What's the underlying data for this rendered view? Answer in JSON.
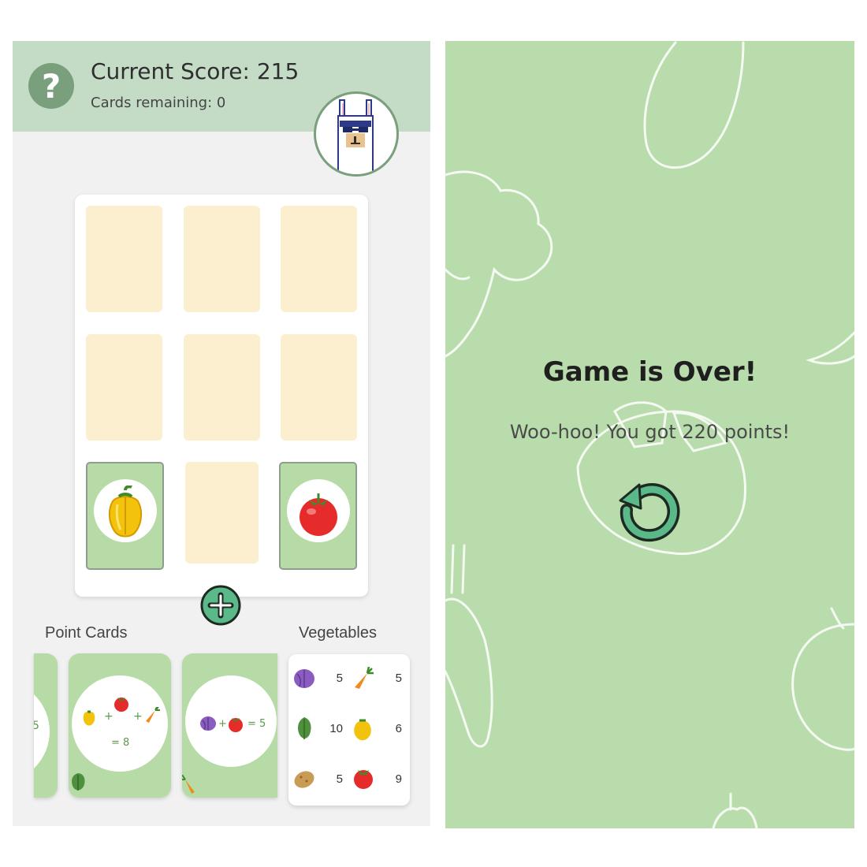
{
  "header": {
    "score_text": "Current Score: 215",
    "remaining_text": "Cards remaining: 0",
    "help_icon": "?"
  },
  "board": {
    "revealed_cards": [
      "yellow-pepper",
      "tomato"
    ],
    "add_icon": "plus-icon"
  },
  "sections": {
    "point_cards_label": "Point Cards",
    "vegetables_label": "Vegetables"
  },
  "point_cards": [
    {
      "partial_text": "5"
    },
    {
      "formula_plus1": "+",
      "formula_plus2": "+",
      "result": "= 8"
    },
    {
      "formula_plus": "+",
      "formula_eq": "= 5"
    }
  ],
  "vegetables": [
    {
      "left_value": "5",
      "right_value": "5"
    },
    {
      "left_value": "10",
      "right_value": "6"
    },
    {
      "left_value": "5",
      "right_value": "9"
    }
  ],
  "game_over": {
    "title": "Game is Over!",
    "message": "Woo-hoo! You got 220 points!"
  },
  "colors": {
    "header_bg": "#c4dcc6",
    "accent_green": "#5bb888",
    "card_back": "#b6dba6",
    "empty_slot": "#fcefd0",
    "gameover_bg": "#b8dcab"
  }
}
